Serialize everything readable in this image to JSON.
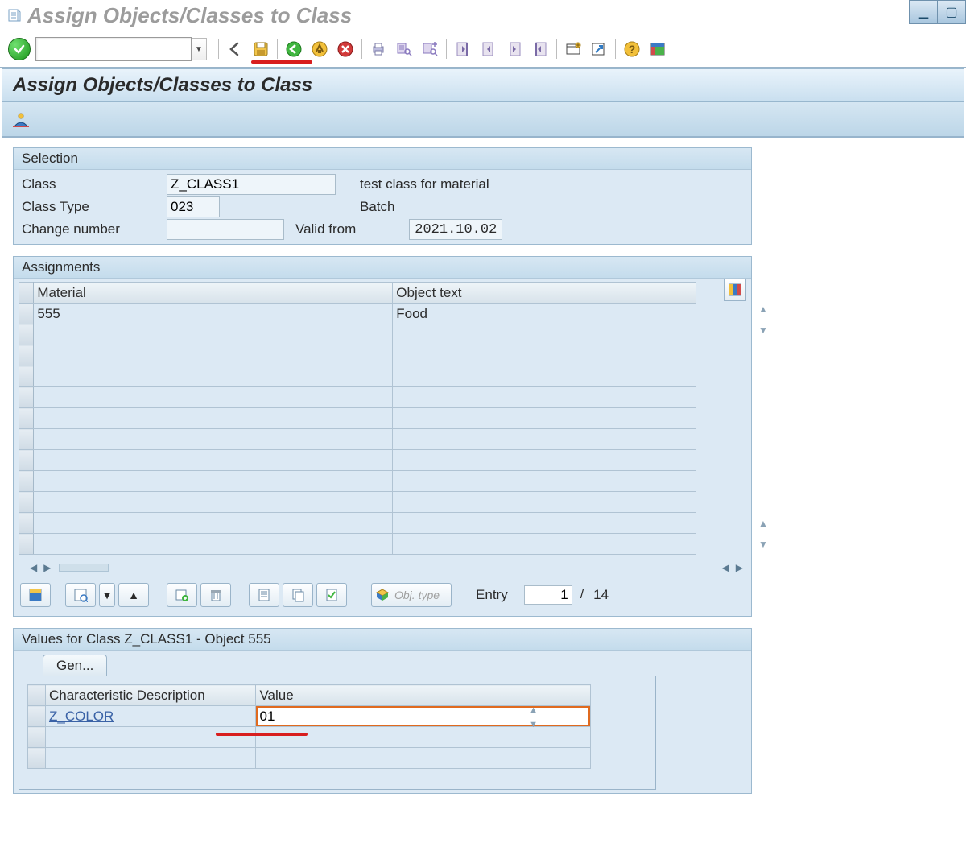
{
  "window": {
    "title": "Assign Objects/Classes to Class"
  },
  "section_header": "Assign Objects/Classes to Class",
  "toolbar_icons": {
    "enter": "enter-icon",
    "back": "back-icon",
    "save": "save-icon",
    "exit_green": "back-green-icon",
    "exit_yellow": "exit-yellow-icon",
    "cancel": "cancel-icon",
    "print": "print-icon",
    "find": "find-icon",
    "find_next": "find-next-icon",
    "first_page": "first-page-icon",
    "prev_page": "prev-page-icon",
    "next_page": "next-page-icon",
    "last_page": "last-page-icon",
    "new_session": "new-session-icon",
    "shortcut": "shortcut-icon",
    "help": "help-icon",
    "layout": "layout-icon"
  },
  "selection": {
    "title": "Selection",
    "class_label": "Class",
    "class_value": "Z_CLASS1",
    "class_desc": "test class for material",
    "class_type_label": "Class Type",
    "class_type_value": "023",
    "class_type_desc": "Batch",
    "change_number_label": "Change number",
    "change_number_value": "",
    "valid_from_label": "Valid from",
    "valid_from_value": "2021.10.02"
  },
  "assignments": {
    "title": "Assignments",
    "col_material": "Material",
    "col_objtext": "Object text",
    "rows": [
      {
        "material": "555",
        "objtext": "Food"
      }
    ],
    "blank_row_count": 11
  },
  "grid_footer": {
    "obj_type_label": "Obj. type",
    "entry_label": "Entry",
    "entry_current": "1",
    "entry_total": "14"
  },
  "values": {
    "title_prefix": "Values for Class ",
    "title_class": "Z_CLASS1",
    "title_mid": " - Object ",
    "title_obj": "555",
    "tab_label": "Gen...",
    "col_desc": "Characteristic Description",
    "col_value": "Value",
    "rows": [
      {
        "desc": "Z_COLOR",
        "value": "01"
      }
    ]
  }
}
